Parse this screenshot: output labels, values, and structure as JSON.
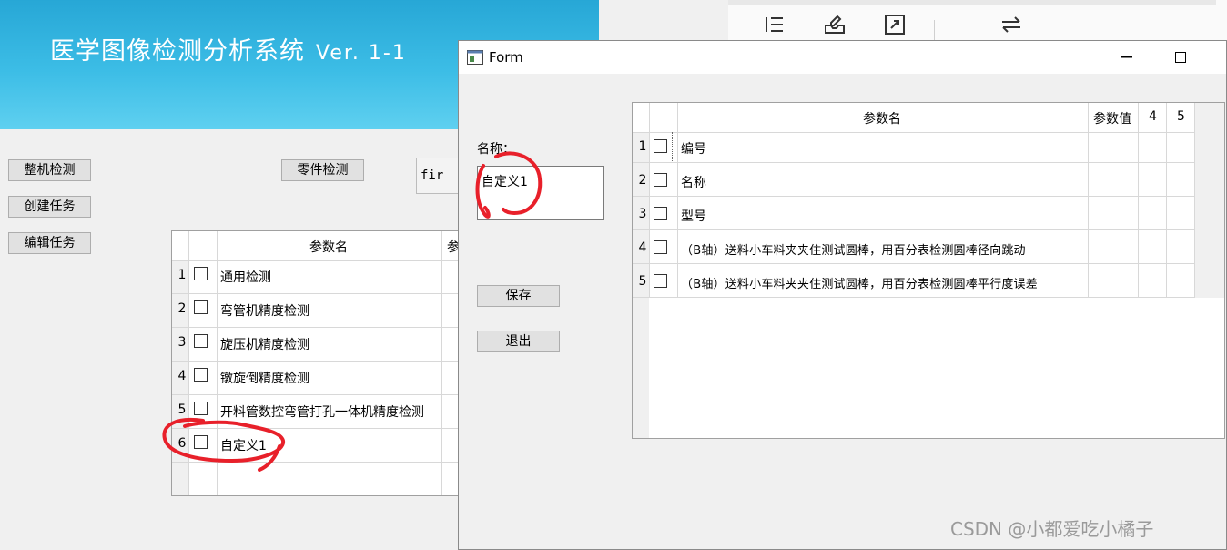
{
  "main": {
    "title": "医学图像检测分析系统",
    "version": "Ver. 1-1",
    "buttons": {
      "inspect_machine": "整机检测",
      "create_task": "创建任务",
      "edit_task": "编辑任务",
      "inspect_parts": "零件检测"
    },
    "text_field_value": "fir",
    "table": {
      "header": "参数名",
      "header_partial": "参",
      "rows": [
        {
          "num": "1",
          "name": "通用检测"
        },
        {
          "num": "2",
          "name": "弯管机精度检测"
        },
        {
          "num": "3",
          "name": "旋压机精度检测"
        },
        {
          "num": "4",
          "name": "镦旋倒精度检测"
        },
        {
          "num": "5",
          "name": "开料管数控弯管打孔一体机精度检测"
        },
        {
          "num": "6",
          "name": "自定义1"
        }
      ]
    }
  },
  "form": {
    "title": "Form",
    "name_label": "名称：",
    "name_value": "自定义1",
    "save_label": "保存",
    "exit_label": "退出",
    "table": {
      "headers": [
        "参数名",
        "参数值",
        "4",
        "5"
      ],
      "rows": [
        {
          "num": "1",
          "name": "编号"
        },
        {
          "num": "2",
          "name": "名称"
        },
        {
          "num": "3",
          "name": "型号"
        },
        {
          "num": "4",
          "name": "（B轴）送料小车料夹夹住测试圆棒，用百分表检测圆棒径向跳动"
        },
        {
          "num": "5",
          "name": "（B轴）送料小车料夹夹住测试圆棒，用百分表检测圆棒平行度误差"
        }
      ]
    }
  },
  "watermark": "CSDN @小都爱吃小橘子",
  "colors": {
    "banner": "#3cbde6",
    "annotation": "#e8202a"
  }
}
